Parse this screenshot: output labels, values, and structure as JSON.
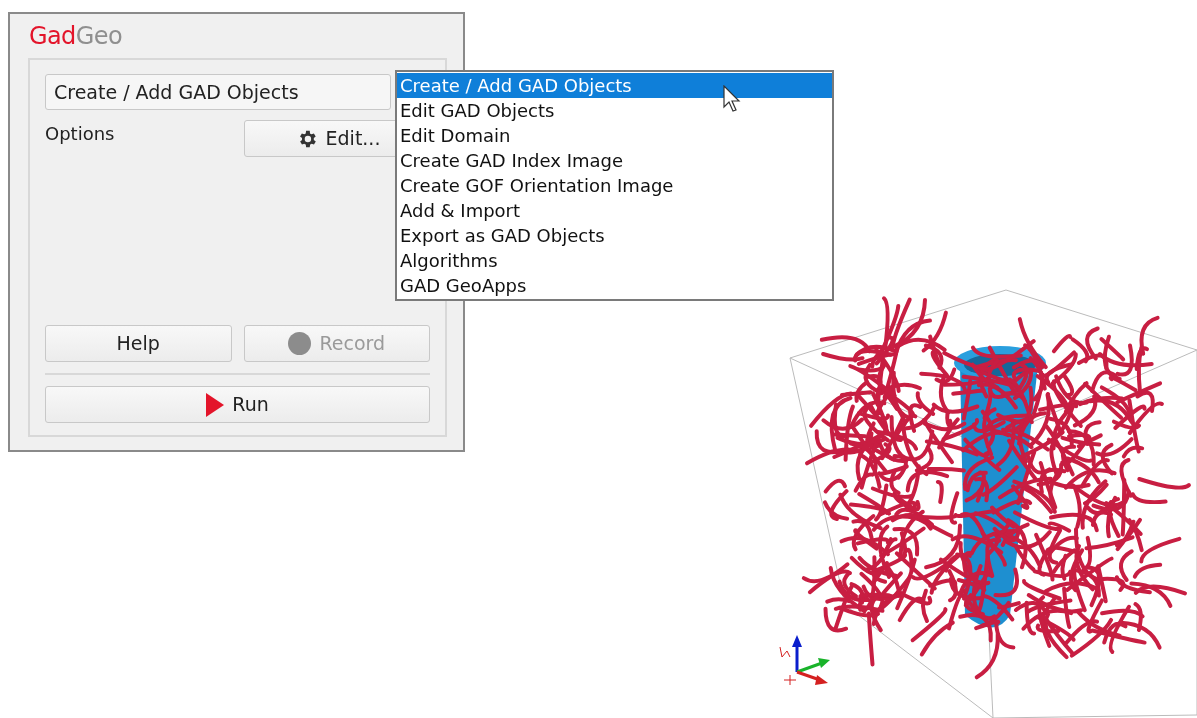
{
  "logo": {
    "primary": "Gad",
    "secondary": "Geo"
  },
  "mode_select": {
    "value": "Create / Add GAD Objects"
  },
  "options_label": "Options",
  "edit_button": {
    "label": "Edit..."
  },
  "mode_options": [
    {
      "label": "Create / Add GAD Objects",
      "selected": true
    },
    {
      "label": "Edit GAD Objects",
      "selected": false
    },
    {
      "label": "Edit Domain",
      "selected": false
    },
    {
      "label": "Create GAD Index Image",
      "selected": false
    },
    {
      "label": "Create GOF Orientation Image",
      "selected": false
    },
    {
      "label": "Add & Import",
      "selected": false
    },
    {
      "label": "Export as GAD Objects",
      "selected": false
    },
    {
      "label": "Algorithms",
      "selected": false
    },
    {
      "label": "GAD GeoApps",
      "selected": false
    }
  ],
  "help_button": {
    "label": "Help",
    "disabled": false
  },
  "record_button": {
    "label": "Record",
    "disabled": true
  },
  "run_button": {
    "label": "Run",
    "disabled": false
  }
}
